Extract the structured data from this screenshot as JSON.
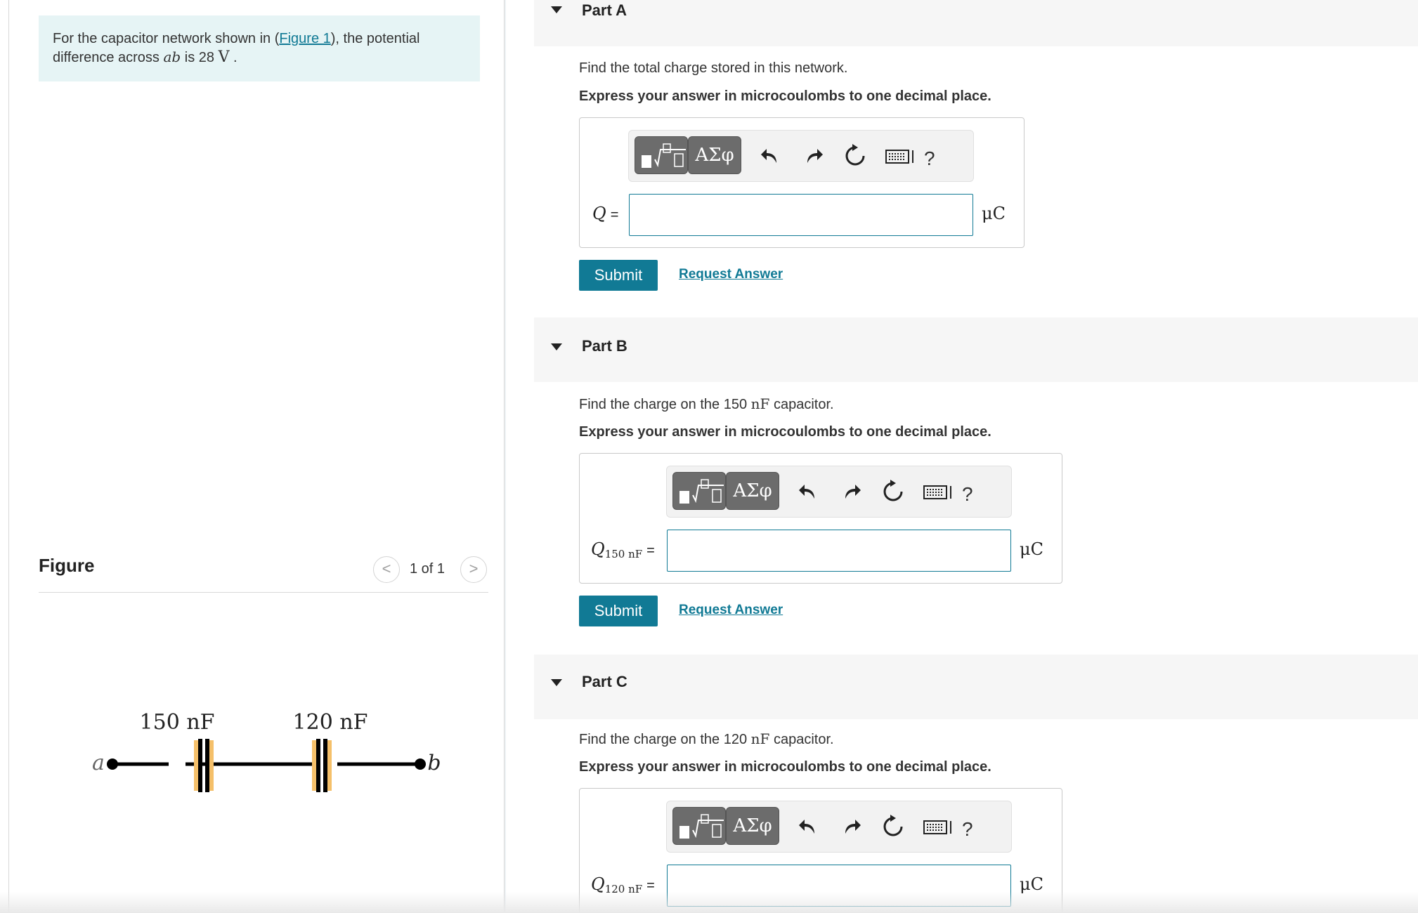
{
  "intro": {
    "prefix": "For the capacitor network shown in (",
    "figure_link": "Figure 1",
    "suffix": "), the potential",
    "line2_prefix": "difference across ",
    "ab": "ab",
    "line2_mid": " is 28 ",
    "unit_v": "V",
    "line2_end": " ."
  },
  "figure": {
    "title": "Figure",
    "pager": "1 of 1",
    "prev": "<",
    "next": ">",
    "cap1_label": "150 nF",
    "cap2_label": "120 nF",
    "node_a": "a",
    "node_b": "b",
    "colors": {
      "capacitor_highlight": "#f5c06a",
      "wire": "#000000"
    }
  },
  "toolbar": {
    "greek": "ΑΣφ",
    "help": "?",
    "icons": [
      "templates-icon",
      "greek-icon",
      "undo-icon",
      "redo-icon",
      "reset-icon",
      "keyboard-icon",
      "help-icon"
    ]
  },
  "parts": [
    {
      "title": "Part A",
      "question_prefix": "Find the total charge stored in this network.",
      "instruction": "Express your answer in microcoulombs to one decimal place.",
      "var": "Q",
      "var_sub": "",
      "eq": "=",
      "unit": "μC",
      "value": "",
      "submit": "Submit",
      "request": "Request Answer"
    },
    {
      "title": "Part B",
      "question_prefix": "Find the charge on the 150 ",
      "question_unit": "nF",
      "question_suffix": " capacitor.",
      "instruction": "Express your answer in microcoulombs to one decimal place.",
      "var": "Q",
      "var_sub": "150 nF",
      "eq": "=",
      "unit": "μC",
      "value": "",
      "submit": "Submit",
      "request": "Request Answer"
    },
    {
      "title": "Part C",
      "question_prefix": "Find the charge on the 120 ",
      "question_unit": "nF",
      "question_suffix": " capacitor.",
      "instruction": "Express your answer in microcoulombs to one decimal place.",
      "var": "Q",
      "var_sub": "120 nF",
      "eq": "=",
      "unit": "μC",
      "value": ""
    }
  ],
  "colors": {
    "accent": "#117a95",
    "intro_bg": "#e6f4f5",
    "part_header_bg": "#f6f6f6",
    "toolbar_btn": "#6c6c6c"
  }
}
